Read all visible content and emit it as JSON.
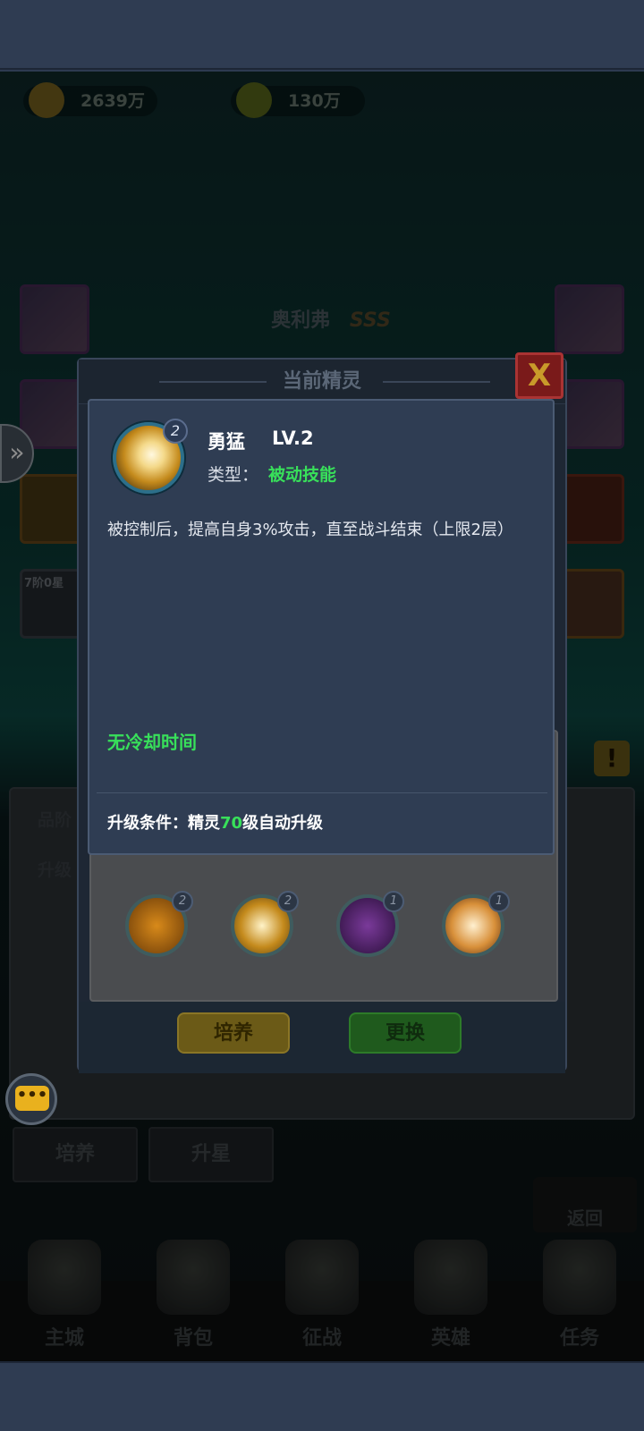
{
  "resources": [
    {
      "value": "2639万",
      "icon": "gold-coin-icon"
    },
    {
      "value": "130万",
      "icon": "green-gem-icon"
    }
  ],
  "hero": {
    "name": "奥利弗",
    "grade": "SSS"
  },
  "side_label": "7阶0星",
  "background_panel": {
    "row1": "品阶",
    "row2": "升级",
    "tab_train": "培养",
    "tab_upgrade": "升星",
    "back": "返回"
  },
  "nav": [
    {
      "label": "主城",
      "icon": "castle-icon"
    },
    {
      "label": "背包",
      "icon": "chest-icon"
    },
    {
      "label": "征战",
      "icon": "dragon-icon"
    },
    {
      "label": "英雄",
      "icon": "helmet-icon"
    },
    {
      "label": "任务",
      "icon": "scroll-icon"
    }
  ],
  "dialog": {
    "title": "当前精灵",
    "close": "X",
    "skills": [
      {
        "level": "2",
        "icon": "fire-orb-icon"
      },
      {
        "level": "2",
        "icon": "lion-roar-icon"
      },
      {
        "level": "1",
        "icon": "shadow-beast-icon"
      },
      {
        "level": "1",
        "icon": "holy-fist-icon"
      }
    ],
    "train_button": "培养",
    "swap_button": "更换"
  },
  "tooltip": {
    "icon_level": "2",
    "name": "勇猛",
    "level": "LV.2",
    "type_label": "类型：",
    "type_value": "被动技能",
    "description": "被控制后，提高自身3%攻击，直至战斗结束（上限2层）",
    "cooldown": "无冷却时间",
    "upgrade_prefix": "升级条件：精灵",
    "upgrade_level": "70",
    "upgrade_suffix": "级自动升级"
  },
  "colors": {
    "accent_green": "#38e05a",
    "tooltip_bg": "#2f3d53",
    "sysbar": "#2f3c52"
  }
}
